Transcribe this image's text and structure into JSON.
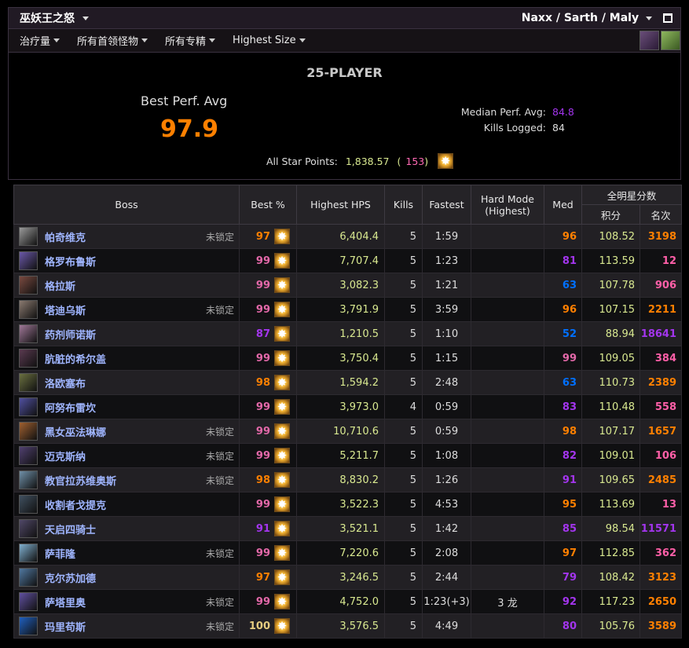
{
  "topbar": {
    "title": "巫妖王之怒",
    "selection": "Naxx / Sarth / Maly"
  },
  "filters": [
    "治疗量",
    "所有首领怪物",
    "所有专精",
    "Highest Size"
  ],
  "summary": {
    "size_title": "25-PLAYER",
    "best_perf_label": "Best Perf. Avg",
    "best_perf_value": "97.9",
    "median_label": "Median Perf. Avg:",
    "median_value": "84.8",
    "kills_label": "Kills Logged:",
    "kills_value": "84",
    "star_label": "All Star Points:",
    "star_points": "1,838.57",
    "star_open": "(",
    "star_count": "153",
    "star_close": ")"
  },
  "table": {
    "headers": {
      "boss": "Boss",
      "best": "Best %",
      "hps": "Highest HPS",
      "kills": "Kills",
      "fastest": "Fastest",
      "hard_mode": "Hard Mode",
      "hard_mode_sub": "(Highest)",
      "med": "Med",
      "allstar": "全明星分数",
      "points": "积分",
      "rank": "名次"
    },
    "rows": [
      {
        "boss": "帕奇维克",
        "locked": "未锁定",
        "best": "97",
        "best_q": "orange",
        "hps": "6,404.4",
        "kills": "5",
        "fastest": "1:59",
        "hard": "",
        "med": "96",
        "med_q": "orange",
        "points": "108.52",
        "rank": "3198",
        "rank_q": "orange",
        "icon": "#9a9a9a"
      },
      {
        "boss": "格罗布鲁斯",
        "locked": "",
        "best": "99",
        "best_q": "pink",
        "hps": "7,707.4",
        "kills": "5",
        "fastest": "1:23",
        "hard": "",
        "med": "81",
        "med_q": "purple",
        "points": "113.59",
        "rank": "12",
        "rank_q": "pink",
        "icon": "#6a58a8"
      },
      {
        "boss": "格拉斯",
        "locked": "",
        "best": "99",
        "best_q": "pink",
        "hps": "3,082.3",
        "kills": "5",
        "fastest": "1:21",
        "hard": "",
        "med": "63",
        "med_q": "blue",
        "points": "107.78",
        "rank": "906",
        "rank_q": "pink",
        "icon": "#7a4a40"
      },
      {
        "boss": "塔迪乌斯",
        "locked": "未锁定",
        "best": "99",
        "best_q": "pink",
        "hps": "3,791.9",
        "kills": "5",
        "fastest": "3:59",
        "hard": "",
        "med": "96",
        "med_q": "orange",
        "points": "107.15",
        "rank": "2211",
        "rank_q": "orange",
        "icon": "#8a7a70"
      },
      {
        "boss": "药剂师诺斯",
        "locked": "",
        "best": "87",
        "best_q": "purple",
        "hps": "1,210.5",
        "kills": "5",
        "fastest": "1:10",
        "hard": "",
        "med": "52",
        "med_q": "blue",
        "points": "88.94",
        "rank": "18641",
        "rank_q": "purple",
        "icon": "#a07898"
      },
      {
        "boss": "肮脏的希尔盖",
        "locked": "",
        "best": "99",
        "best_q": "pink",
        "hps": "3,750.4",
        "kills": "5",
        "fastest": "1:15",
        "hard": "",
        "med": "99",
        "med_q": "pink",
        "points": "109.05",
        "rank": "384",
        "rank_q": "pink",
        "icon": "#5a3a50"
      },
      {
        "boss": "洛欧塞布",
        "locked": "",
        "best": "98",
        "best_q": "orange",
        "hps": "1,594.2",
        "kills": "5",
        "fastest": "2:48",
        "hard": "",
        "med": "63",
        "med_q": "blue",
        "points": "110.73",
        "rank": "2389",
        "rank_q": "orange",
        "icon": "#6a7040"
      },
      {
        "boss": "阿努布雷坎",
        "locked": "",
        "best": "99",
        "best_q": "pink",
        "hps": "3,973.0",
        "kills": "4",
        "fastest": "0:59",
        "hard": "",
        "med": "83",
        "med_q": "purple",
        "points": "110.48",
        "rank": "558",
        "rank_q": "pink",
        "icon": "#5050a0"
      },
      {
        "boss": "黑女巫法琳娜",
        "locked": "未锁定",
        "best": "99",
        "best_q": "pink",
        "hps": "10,710.6",
        "kills": "5",
        "fastest": "0:59",
        "hard": "",
        "med": "98",
        "med_q": "orange",
        "points": "107.17",
        "rank": "1657",
        "rank_q": "orange",
        "icon": "#a06030"
      },
      {
        "boss": "迈克斯纳",
        "locked": "未锁定",
        "best": "99",
        "best_q": "pink",
        "hps": "5,211.7",
        "kills": "5",
        "fastest": "1:08",
        "hard": "",
        "med": "82",
        "med_q": "purple",
        "points": "109.01",
        "rank": "106",
        "rank_q": "pink",
        "icon": "#504070"
      },
      {
        "boss": "教官拉苏维奥斯",
        "locked": "未锁定",
        "best": "98",
        "best_q": "orange",
        "hps": "8,830.2",
        "kills": "5",
        "fastest": "1:26",
        "hard": "",
        "med": "91",
        "med_q": "purple",
        "points": "109.65",
        "rank": "2485",
        "rank_q": "orange",
        "icon": "#7090a8"
      },
      {
        "boss": "收割者戈提克",
        "locked": "",
        "best": "99",
        "best_q": "pink",
        "hps": "3,522.3",
        "kills": "5",
        "fastest": "4:53",
        "hard": "",
        "med": "95",
        "med_q": "orange",
        "points": "113.69",
        "rank": "13",
        "rank_q": "pink",
        "icon": "#405060"
      },
      {
        "boss": "天启四骑士",
        "locked": "",
        "best": "91",
        "best_q": "purple",
        "hps": "3,521.1",
        "kills": "5",
        "fastest": "1:42",
        "hard": "",
        "med": "85",
        "med_q": "purple",
        "points": "98.54",
        "rank": "11571",
        "rank_q": "purple",
        "icon": "#504868"
      },
      {
        "boss": "萨菲隆",
        "locked": "未锁定",
        "best": "99",
        "best_q": "pink",
        "hps": "7,220.6",
        "kills": "5",
        "fastest": "2:08",
        "hard": "",
        "med": "97",
        "med_q": "orange",
        "points": "112.85",
        "rank": "362",
        "rank_q": "pink",
        "icon": "#80b0d0"
      },
      {
        "boss": "克尔苏加德",
        "locked": "",
        "best": "97",
        "best_q": "orange",
        "hps": "3,246.5",
        "kills": "5",
        "fastest": "2:44",
        "hard": "",
        "med": "79",
        "med_q": "purple",
        "points": "108.42",
        "rank": "3123",
        "rank_q": "orange",
        "icon": "#5078a0"
      },
      {
        "boss": "萨塔里奥",
        "locked": "未锁定",
        "best": "99",
        "best_q": "pink",
        "hps": "4,752.0",
        "kills": "5",
        "fastest": "1:23(+3)",
        "hard": "3 龙",
        "med": "92",
        "med_q": "purple",
        "points": "117.23",
        "rank": "2650",
        "rank_q": "orange",
        "icon": "#6050a0"
      },
      {
        "boss": "玛里苟斯",
        "locked": "未锁定",
        "best": "100",
        "best_q": "gold",
        "hps": "3,576.5",
        "kills": "5",
        "fastest": "4:49",
        "hard": "",
        "med": "80",
        "med_q": "purple",
        "points": "105.76",
        "rank": "3589",
        "rank_q": "orange",
        "icon": "#2060c0"
      }
    ]
  },
  "colors": {
    "orange": "#ff8000",
    "pink": "#e268a8",
    "purple": "#a335ee",
    "blue": "#0070ff",
    "gold": "#e5cc80",
    "hps": "#d8e890",
    "boss_link": "#9fb5ff"
  }
}
